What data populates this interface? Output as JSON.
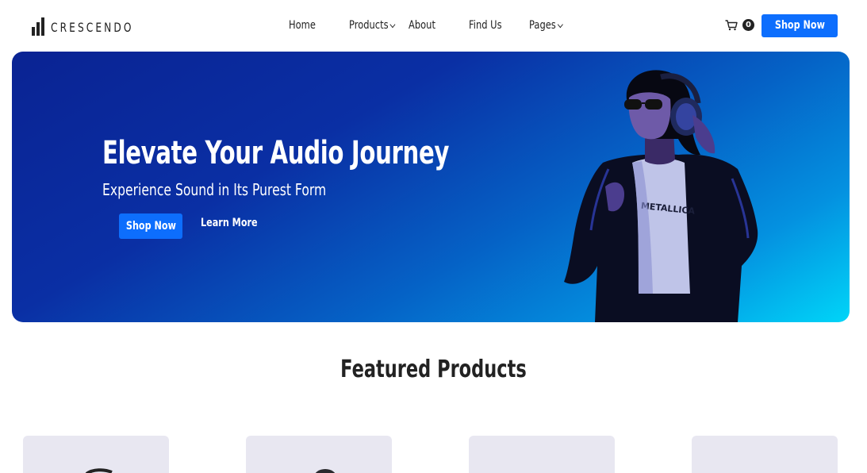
{
  "brand": {
    "name": "CRESCENDO",
    "icon": "bar-chart-icon"
  },
  "nav": {
    "items": [
      {
        "label": "Home",
        "dropdown": false
      },
      {
        "label": "Products",
        "dropdown": true
      },
      {
        "label": "About",
        "dropdown": false
      },
      {
        "label": "Find Us",
        "dropdown": false
      },
      {
        "label": "Pages",
        "dropdown": true
      }
    ],
    "cart_icon": "shopping-cart-icon",
    "cart_count": "0",
    "shop_button": "Shop Now"
  },
  "hero": {
    "title": "Elevate Your Audio Journey",
    "subtitle": "Experience Sound in Its Purest Form",
    "primary_button": "Shop Now",
    "secondary_link": "Learn More",
    "image": "woman-with-headphones",
    "colors": {
      "gradient_start": "#0a2393",
      "gradient_end": "#00d5f8"
    }
  },
  "featured": {
    "title": "Featured Products",
    "cards": [
      {
        "image": "headphones-product-thumb"
      },
      {
        "image": "earbud-product-thumb"
      },
      {
        "image": "product-thumb"
      },
      {
        "image": "product-thumb"
      }
    ]
  },
  "colors": {
    "accent": "#0d6efd",
    "text": "#222222",
    "card_bg": "#e8e7f1"
  }
}
